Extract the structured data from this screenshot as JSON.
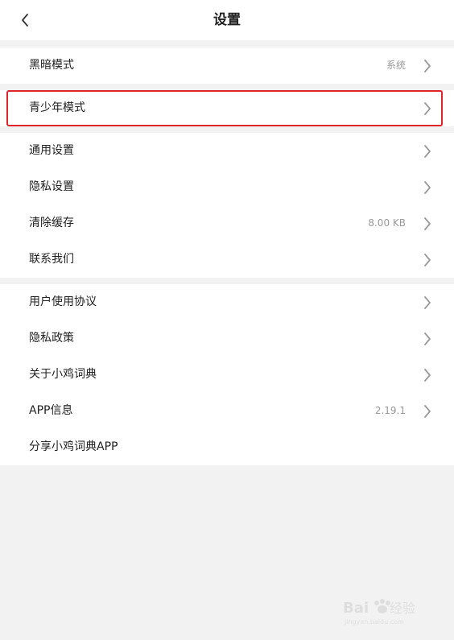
{
  "header": {
    "title": "设置",
    "back_icon": "chevron-left-icon"
  },
  "sections": [
    {
      "items": [
        {
          "label": "黑暗模式",
          "value": "系统",
          "chevron": true
        }
      ]
    },
    {
      "items": [
        {
          "label": "青少年模式",
          "value": "",
          "chevron": true,
          "highlighted": true
        }
      ]
    },
    {
      "items": [
        {
          "label": "通用设置",
          "value": "",
          "chevron": true
        },
        {
          "label": "隐私设置",
          "value": "",
          "chevron": true
        },
        {
          "label": "清除缓存",
          "value": "8.00 KB",
          "chevron": true
        },
        {
          "label": "联系我们",
          "value": "",
          "chevron": true
        }
      ]
    },
    {
      "items": [
        {
          "label": "用户使用协议",
          "value": "",
          "chevron": true
        },
        {
          "label": "隐私政策",
          "value": "",
          "chevron": true
        },
        {
          "label": "关于小鸡词典",
          "value": "",
          "chevron": true
        },
        {
          "label": "APP信息",
          "value": "2.19.1",
          "chevron": true
        },
        {
          "label": "分享小鸡词典APP",
          "value": "",
          "chevron": false
        }
      ]
    }
  ],
  "colors": {
    "highlight_border": "#e0252a",
    "background": "#f2f2f2",
    "secondary_text": "#999999"
  }
}
